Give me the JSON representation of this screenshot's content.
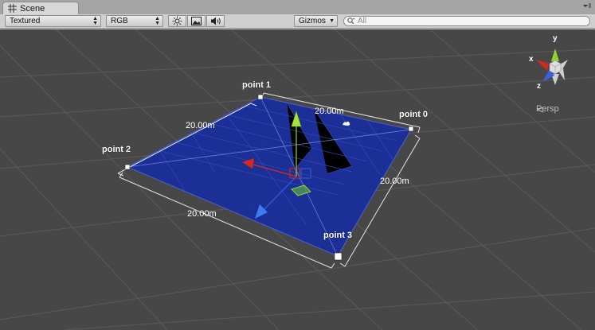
{
  "tab": {
    "title": "Scene"
  },
  "toolbar": {
    "render_mode": "Textured",
    "color_mode": "RGB",
    "gizmos_label": "Gizmos",
    "search_placeholder": "All"
  },
  "scene": {
    "points": [
      {
        "label": "point 0"
      },
      {
        "label": "point 1"
      },
      {
        "label": "point 2"
      },
      {
        "label": "point 3"
      }
    ],
    "dimensions": [
      "20.00m",
      "20.00m",
      "20.00m",
      "20.00m"
    ],
    "projection_label": "Persp",
    "axis_labels": {
      "x": "x",
      "y": "y",
      "z": "z"
    },
    "colors": {
      "plane": "#1a2e9c",
      "background": "#474747",
      "x_axis": "#d42a1c",
      "y_axis": "#8ed42a",
      "z_axis": "#2f5fe0"
    }
  }
}
